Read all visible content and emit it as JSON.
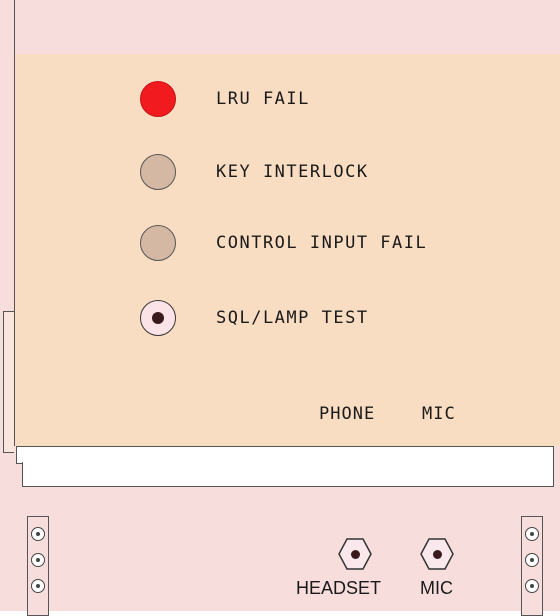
{
  "indicators": [
    {
      "label": "LRU FAIL",
      "state": "red",
      "color": "#f11b1f"
    },
    {
      "label": "KEY INTERLOCK",
      "state": "off",
      "color": "#d4b8a4"
    },
    {
      "label": "CONTROL INPUT FAIL",
      "state": "off",
      "color": "#d4b8a4"
    },
    {
      "label": "SQL/LAMP TEST",
      "state": "button",
      "color": "#fce3e8"
    }
  ],
  "panel_jacks": {
    "phone_label": "PHONE",
    "mic_label": "MIC"
  },
  "front_jacks": {
    "headset_label": "HEADSET",
    "mic_label": "MIC"
  },
  "colors": {
    "panel": "#f9ddc3",
    "frame": "#f7dedd"
  }
}
